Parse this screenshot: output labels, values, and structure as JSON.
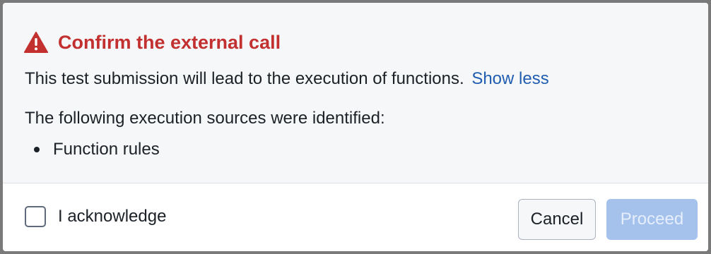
{
  "dialog": {
    "title": "Confirm the external call",
    "title_icon": "warning-triangle-icon",
    "description": "This test submission will lead to the execution of functions.",
    "toggle_link": "Show less",
    "sources_heading": "The following execution sources were identified:",
    "sources": [
      "Function rules"
    ]
  },
  "footer": {
    "acknowledge_label": "I acknowledge",
    "acknowledge_checked": false,
    "cancel_label": "Cancel",
    "proceed_label": "Proceed",
    "proceed_disabled": true
  },
  "colors": {
    "danger": "#c23030",
    "link": "#215db0",
    "primary_disabled": "#a4c2ec",
    "body_background": "#f6f7f9"
  }
}
